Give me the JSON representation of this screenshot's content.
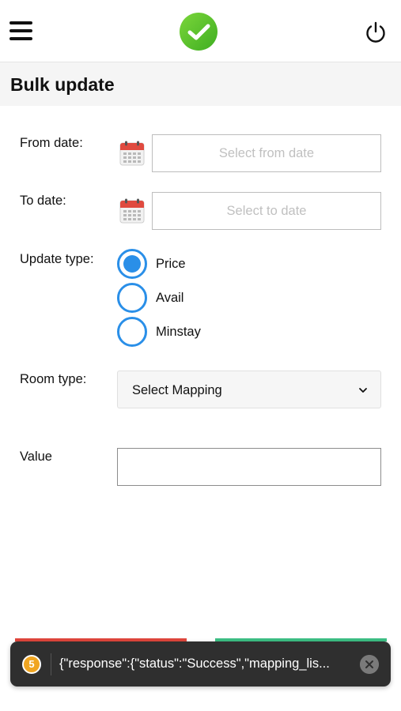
{
  "header": {
    "logo": "check-logo-icon",
    "menu_icon": "hamburger-menu-icon",
    "power_icon": "power-icon"
  },
  "page": {
    "title": "Bulk update"
  },
  "form": {
    "from_date": {
      "label": "From date:",
      "placeholder": "Select from date",
      "icon": "calendar-icon"
    },
    "to_date": {
      "label": "To date:",
      "placeholder": "Select to date",
      "icon": "calendar-icon"
    },
    "update_type": {
      "label": "Update type:",
      "options": [
        "Price",
        "Avail",
        "Minstay"
      ],
      "selected": "Price"
    },
    "room_type": {
      "label": "Room type:",
      "selected": "Select Mapping"
    },
    "value": {
      "label": "Value",
      "value": ""
    }
  },
  "toast": {
    "count": "5",
    "message": "{\"response\":{\"status\":\"Success\",\"mapping_lis..."
  },
  "colors": {
    "accent": "#2a8fe8",
    "logo_green": "#5cc52f",
    "danger_strip": "#e0463c",
    "success_strip": "#3dbf85",
    "toast_bg": "#2f2f2f",
    "toast_badge": "#f0a521"
  }
}
